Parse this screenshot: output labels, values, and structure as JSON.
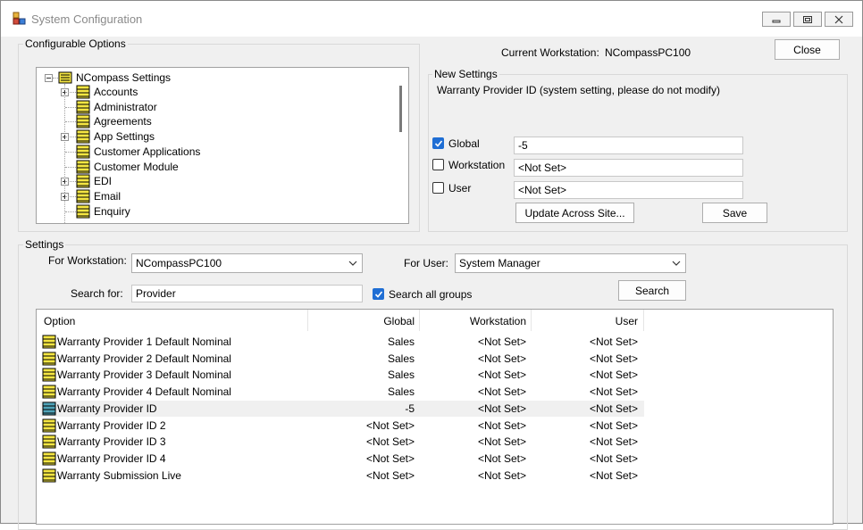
{
  "window": {
    "title": "System Configuration"
  },
  "configurable_options": {
    "label": "Configurable Options",
    "tree": {
      "root": "NCompass Settings",
      "items": [
        {
          "label": "Accounts",
          "expandable": true
        },
        {
          "label": "Administrator",
          "expandable": false
        },
        {
          "label": "Agreements",
          "expandable": false
        },
        {
          "label": "App Settings",
          "expandable": true
        },
        {
          "label": "Customer Applications",
          "expandable": false
        },
        {
          "label": "Customer Module",
          "expandable": false
        },
        {
          "label": "EDI",
          "expandable": true
        },
        {
          "label": "Email",
          "expandable": true
        },
        {
          "label": "Enquiry",
          "expandable": false
        }
      ]
    }
  },
  "current_workstation": {
    "label": "Current Workstation:",
    "value": "NCompassPC100"
  },
  "close_label": "Close",
  "new_settings": {
    "label": "New Settings",
    "description": "Warranty Provider ID (system setting, please do not modify)",
    "global": {
      "label": "Global",
      "checked": true,
      "value": "-5"
    },
    "workstation": {
      "label": "Workstation",
      "checked": false,
      "value": "<Not Set>"
    },
    "user": {
      "label": "User",
      "checked": false,
      "value": "<Not Set>"
    },
    "update_label": "Update Across Site...",
    "save_label": "Save"
  },
  "settings": {
    "label": "Settings",
    "for_workstation_label": "For Workstation:",
    "for_workstation_value": "NCompassPC100",
    "for_user_label": "For User:",
    "for_user_value": "System Manager",
    "search_for_label": "Search for:",
    "search_value": "Provider",
    "search_all_groups_label": "Search all groups",
    "search_all_groups_checked": true,
    "search_label": "Search"
  },
  "table": {
    "columns": [
      "Option",
      "Global",
      "Workstation",
      "User"
    ],
    "rows": [
      {
        "option": "Warranty Provider 1 Default Nominal",
        "global": "Sales",
        "workstation": "<Not Set>",
        "user": "<Not Set>"
      },
      {
        "option": "Warranty Provider 2 Default Nominal",
        "global": "Sales",
        "workstation": "<Not Set>",
        "user": "<Not Set>"
      },
      {
        "option": "Warranty Provider 3 Default Nominal",
        "global": "Sales",
        "workstation": "<Not Set>",
        "user": "<Not Set>"
      },
      {
        "option": "Warranty Provider 4 Default Nominal",
        "global": "Sales",
        "workstation": "<Not Set>",
        "user": "<Not Set>"
      },
      {
        "option": "Warranty Provider ID",
        "global": "-5",
        "workstation": "<Not Set>",
        "user": "<Not Set>",
        "selected": true
      },
      {
        "option": "Warranty Provider ID 2",
        "global": "<Not Set>",
        "workstation": "<Not Set>",
        "user": "<Not Set>"
      },
      {
        "option": "Warranty Provider ID 3",
        "global": "<Not Set>",
        "workstation": "<Not Set>",
        "user": "<Not Set>"
      },
      {
        "option": "Warranty Provider ID 4",
        "global": "<Not Set>",
        "workstation": "<Not Set>",
        "user": "<Not Set>"
      },
      {
        "option": "Warranty Submission Live",
        "global": "<Not Set>",
        "workstation": "<Not Set>",
        "user": "<Not Set>"
      }
    ]
  },
  "colors": {
    "accent": "#1f6ed4",
    "book_icon": "#f5e642",
    "book_icon_selected": "#4fa3b8"
  },
  "icons": {
    "title": "app-icon",
    "tree_node": "book-icon",
    "row": "book-icon",
    "check": "checkmark-icon",
    "dropdown": "chevron-down-icon"
  }
}
